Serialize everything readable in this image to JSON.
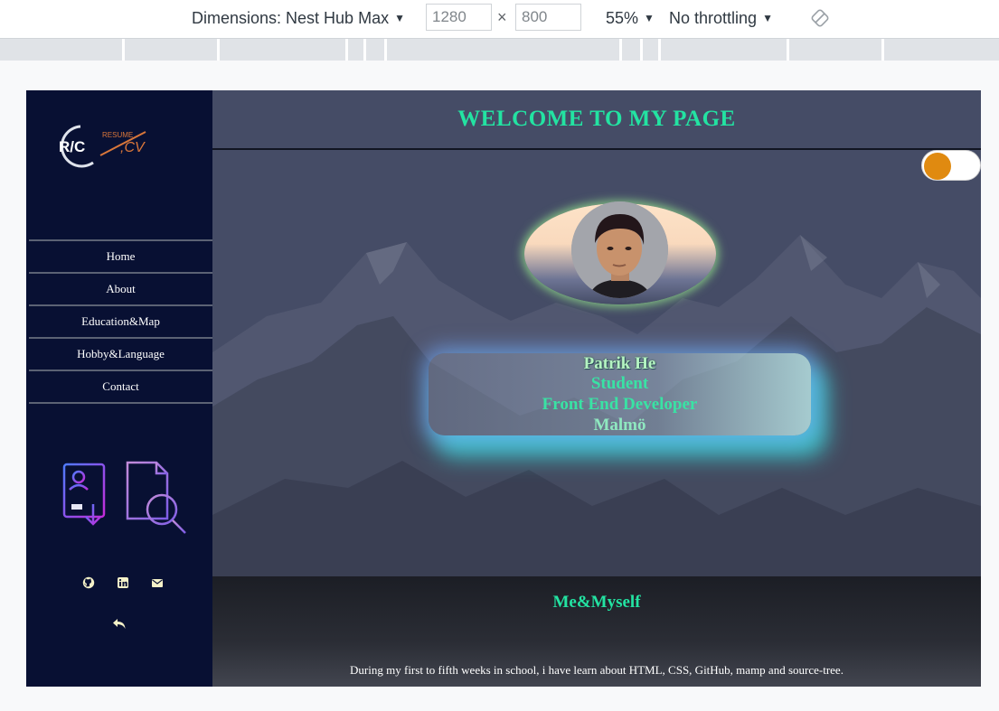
{
  "devtools": {
    "dimensions_label": "Dimensions: Nest Hub Max",
    "width_value": "1280",
    "height_value": "800",
    "times": "×",
    "zoom": "55%",
    "throttling": "No throttling",
    "caret": "▼"
  },
  "sidebar": {
    "logo": {
      "initials": "R/C",
      "resume": "RESUME",
      "cv": ",CV"
    },
    "nav": [
      {
        "label": "Home"
      },
      {
        "label": "About"
      },
      {
        "label": "Education&Map"
      },
      {
        "label": "Hobby&Language"
      },
      {
        "label": "Contact"
      }
    ],
    "social_icons": [
      "github-icon",
      "linkedin-icon",
      "mail-icon"
    ],
    "back_icon": "reply-arrow-icon"
  },
  "header": {
    "title": "WELCOME TO MY PAGE"
  },
  "theme_toggle": {
    "state": "off",
    "knob_color": "#e08a10"
  },
  "profile": {
    "name": "Patrik He",
    "role": "Student",
    "title": "Front End Developer",
    "city": "Malmö"
  },
  "footer": {
    "heading": "Me&Myself",
    "text": "During my first to fifth weeks in school, i have learn about HTML, CSS, GitHub, mamp and source-tree."
  },
  "colors": {
    "accent_green": "#23e3a2",
    "sidebar_bg": "#081033",
    "main_bg": "#454c66",
    "toggle_knob": "#e08a10"
  }
}
